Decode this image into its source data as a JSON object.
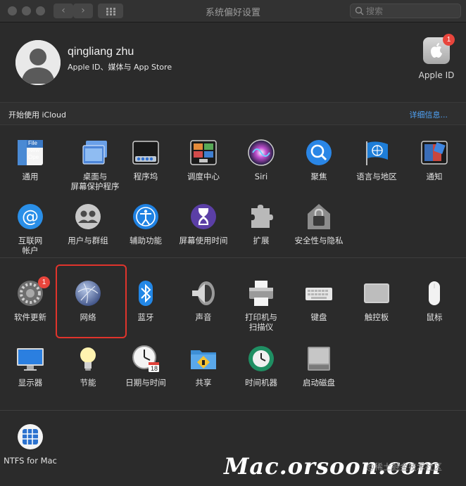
{
  "window": {
    "title": "系统偏好设置",
    "search_placeholder": "搜索",
    "back_glyph": "‹",
    "forward_glyph": "›"
  },
  "account": {
    "name": "qingliang zhu",
    "subtitle": "Apple ID、媒体与 App Store",
    "apple_id_label": "Apple ID",
    "apple_id_badge": "1"
  },
  "icloud": {
    "text": "开始使用 iCloud",
    "link": "详细信息..."
  },
  "prefs": {
    "row1": [
      {
        "label": "通用",
        "icon": "general-icon"
      },
      {
        "label": "桌面与\n屏幕保护程序",
        "icon": "desktop-icon"
      },
      {
        "label": "程序坞",
        "icon": "dock-icon"
      },
      {
        "label": "调度中心",
        "icon": "mission-control-icon"
      },
      {
        "label": "Siri",
        "icon": "siri-icon"
      },
      {
        "label": "聚焦",
        "icon": "spotlight-icon"
      },
      {
        "label": "语言与地区",
        "icon": "language-icon"
      },
      {
        "label": "通知",
        "icon": "notifications-icon"
      }
    ],
    "row2": [
      {
        "label": "互联网\n帐户",
        "icon": "internet-accounts-icon"
      },
      {
        "label": "用户与群组",
        "icon": "users-icon"
      },
      {
        "label": "辅助功能",
        "icon": "accessibility-icon"
      },
      {
        "label": "屏幕使用时间",
        "icon": "screen-time-icon"
      },
      {
        "label": "扩展",
        "icon": "extensions-icon"
      },
      {
        "label": "安全性与隐私",
        "icon": "security-icon"
      }
    ],
    "row3": [
      {
        "label": "软件更新",
        "icon": "software-update-icon",
        "badge": "1"
      },
      {
        "label": "网络",
        "icon": "network-icon"
      },
      {
        "label": "蓝牙",
        "icon": "bluetooth-icon"
      },
      {
        "label": "声音",
        "icon": "sound-icon"
      },
      {
        "label": "打印机与\n扫描仪",
        "icon": "printer-icon"
      },
      {
        "label": "键盘",
        "icon": "keyboard-icon"
      },
      {
        "label": "触控板",
        "icon": "trackpad-icon"
      },
      {
        "label": "鼠标",
        "icon": "mouse-icon"
      }
    ],
    "row4": [
      {
        "label": "显示器",
        "icon": "display-icon"
      },
      {
        "label": "节能",
        "icon": "energy-saver-icon"
      },
      {
        "label": "日期与时间",
        "icon": "clock-icon",
        "calendar_day": "18"
      },
      {
        "label": "共享",
        "icon": "sharing-icon"
      },
      {
        "label": "时间机器",
        "icon": "time-machine-icon"
      },
      {
        "label": "启动磁盘",
        "icon": "startup-disk-icon"
      }
    ],
    "row5": [
      {
        "label": "NTFS for Mac",
        "icon": "ntfs-icon"
      }
    ]
  },
  "general_icon_text": "File\nNew\nOpe",
  "watermark": "Mac.orsoon.com",
  "watermark_sub": "@稀土掘金技术社区",
  "colors": {
    "accent_link": "#4fa3f7",
    "badge": "#e8453c",
    "highlight": "#e0342c"
  }
}
